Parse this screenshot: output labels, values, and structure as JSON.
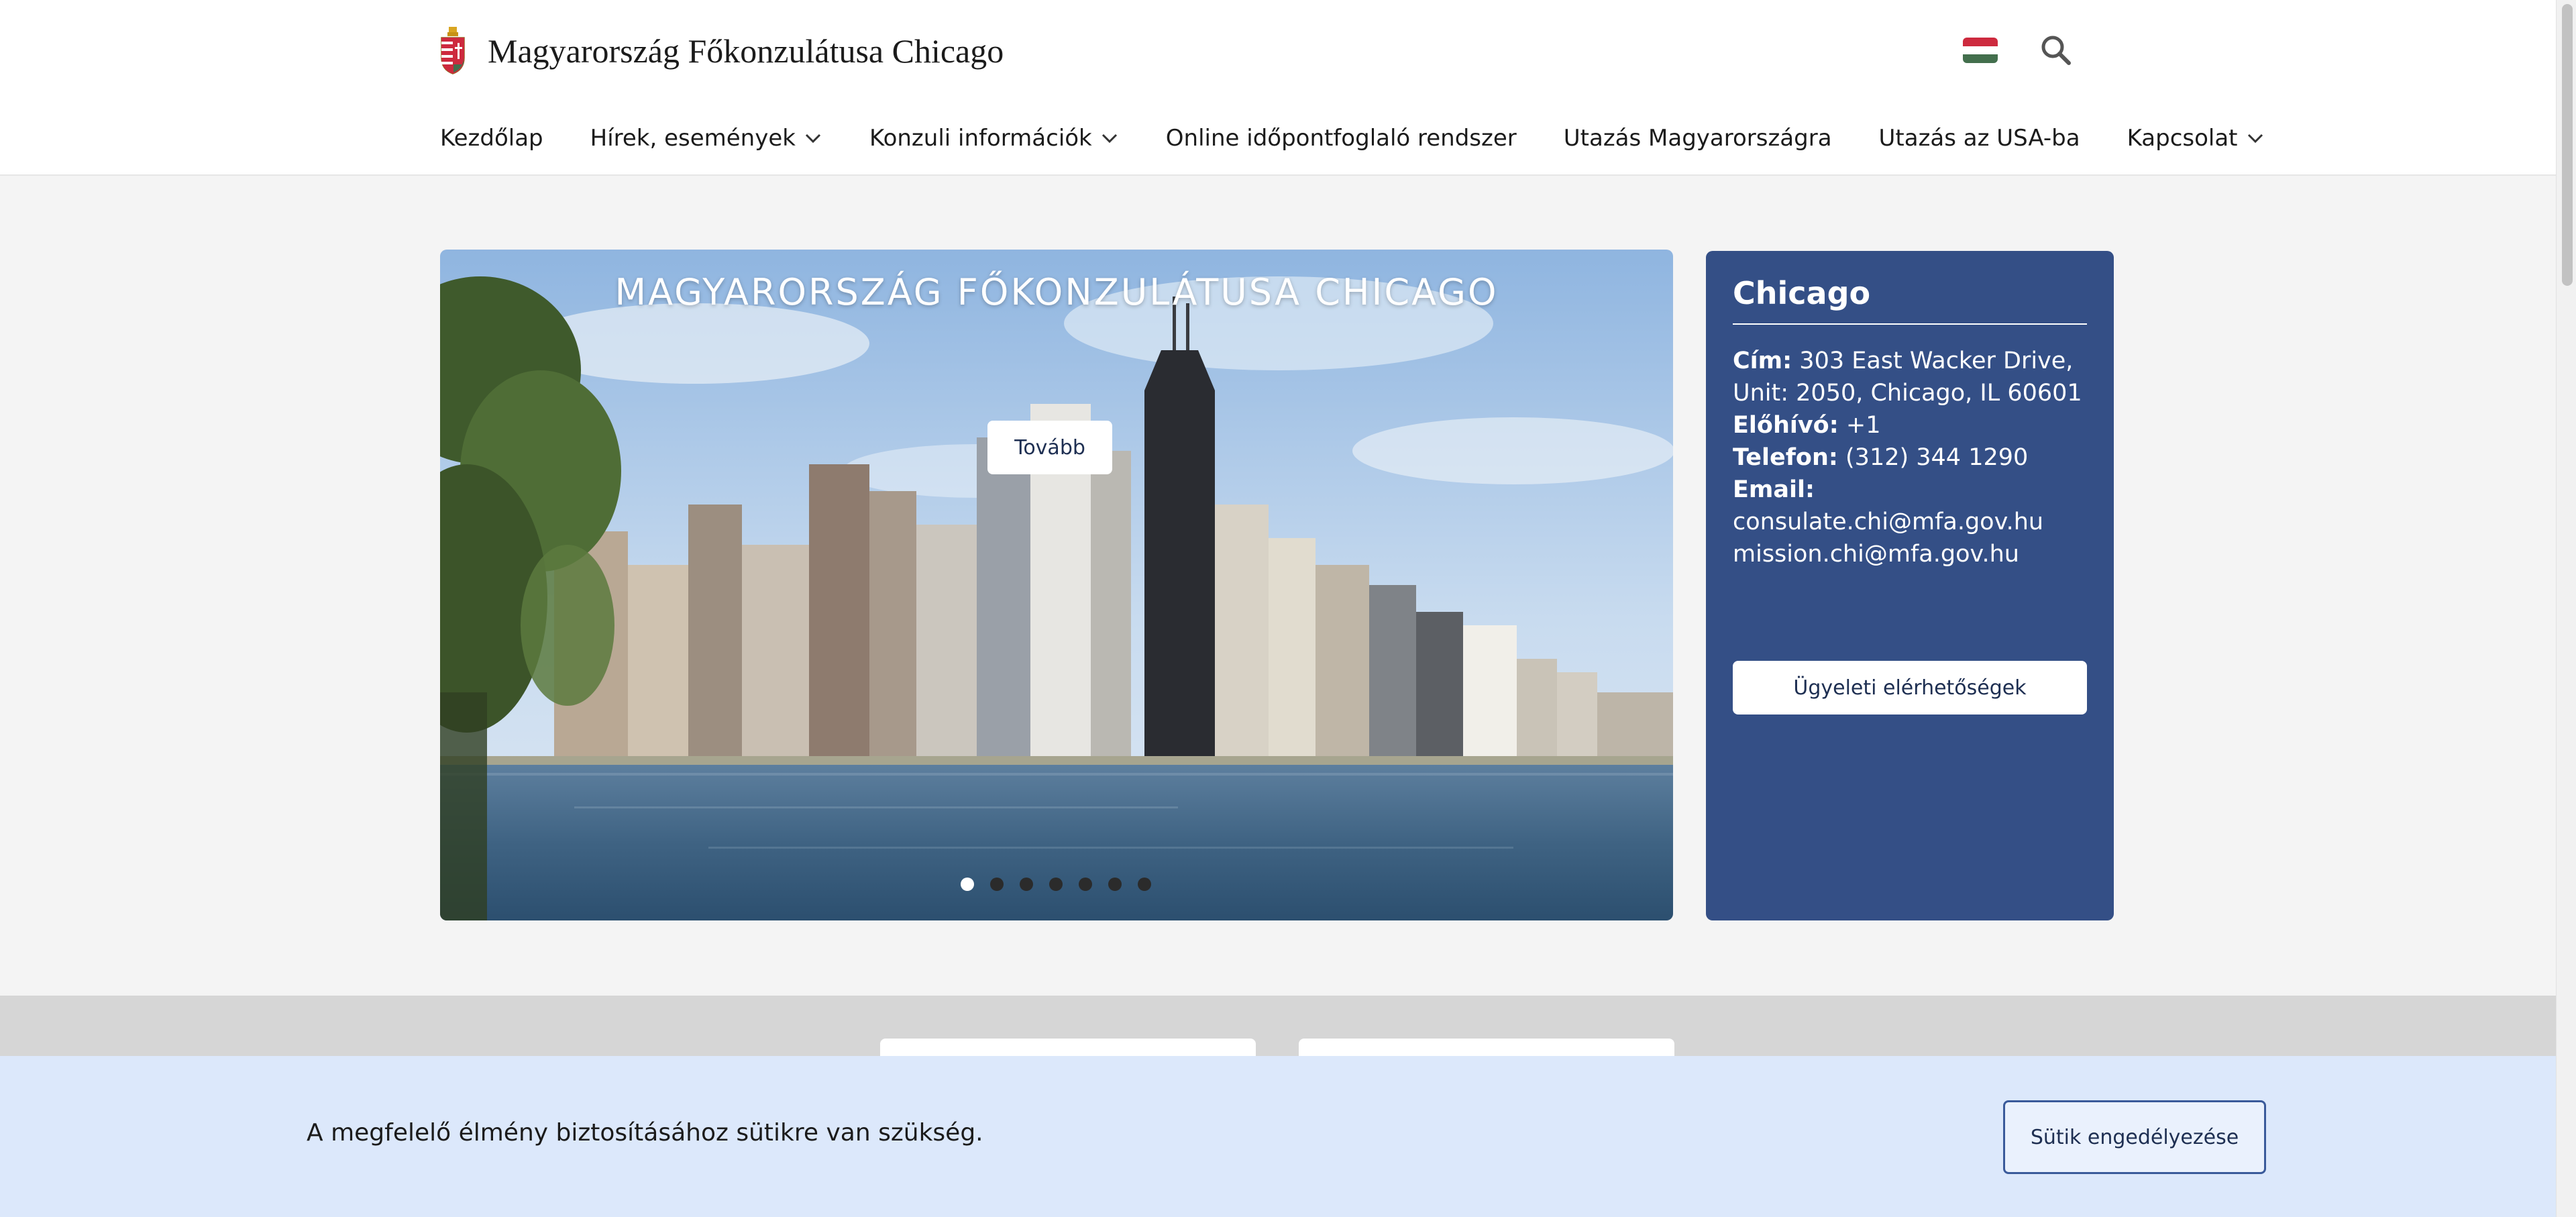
{
  "header": {
    "site_title": "Magyarország Főkonzulátusa Chicago",
    "flag_colors": [
      "#cd2a3e",
      "#ffffff",
      "#436f4d"
    ],
    "search_icon": "search-icon",
    "nav": [
      {
        "label": "Kezdőlap",
        "has_dropdown": false
      },
      {
        "label": "Hírek, események",
        "has_dropdown": true
      },
      {
        "label": "Konzuli információk",
        "has_dropdown": true
      },
      {
        "label": "Online időpontfoglaló rendszer",
        "has_dropdown": false
      },
      {
        "label": "Utazás Magyarországra",
        "has_dropdown": false
      },
      {
        "label": "Utazás az USA-ba",
        "has_dropdown": false
      },
      {
        "label": "Kapcsolat",
        "has_dropdown": true
      }
    ]
  },
  "hero": {
    "title": "MAGYARORSZÁG FŐKONZULÁTUSA CHICAGO",
    "button_label": "Tovább",
    "slide_count": 7,
    "active_slide": 1
  },
  "info_card": {
    "title": "Chicago",
    "address_label": "Cím:",
    "address_value": "303 East Wacker Drive, Unit: 2050, Chicago, IL 60601",
    "prefix_label": "Előhívó:",
    "prefix_value": "+1",
    "phone_label": "Telefon:",
    "phone_value": "(312) 344 1290",
    "email_label": "Email:",
    "email_1": "consulate.chi@mfa.gov.hu",
    "email_2": "mission.chi@mfa.gov.hu",
    "button_label": "Ügyeleti elérhetőségek",
    "background_color": "#344f86"
  },
  "cookie_bar": {
    "text": "A megfelelő élmény biztosításához sütikre van szükség.",
    "button_label": "Sütik engedélyezése"
  },
  "colors": {
    "brand_blue": "#344f86",
    "dark_navy": "#1e2f52",
    "cookie_bg": "#dce8fb"
  }
}
